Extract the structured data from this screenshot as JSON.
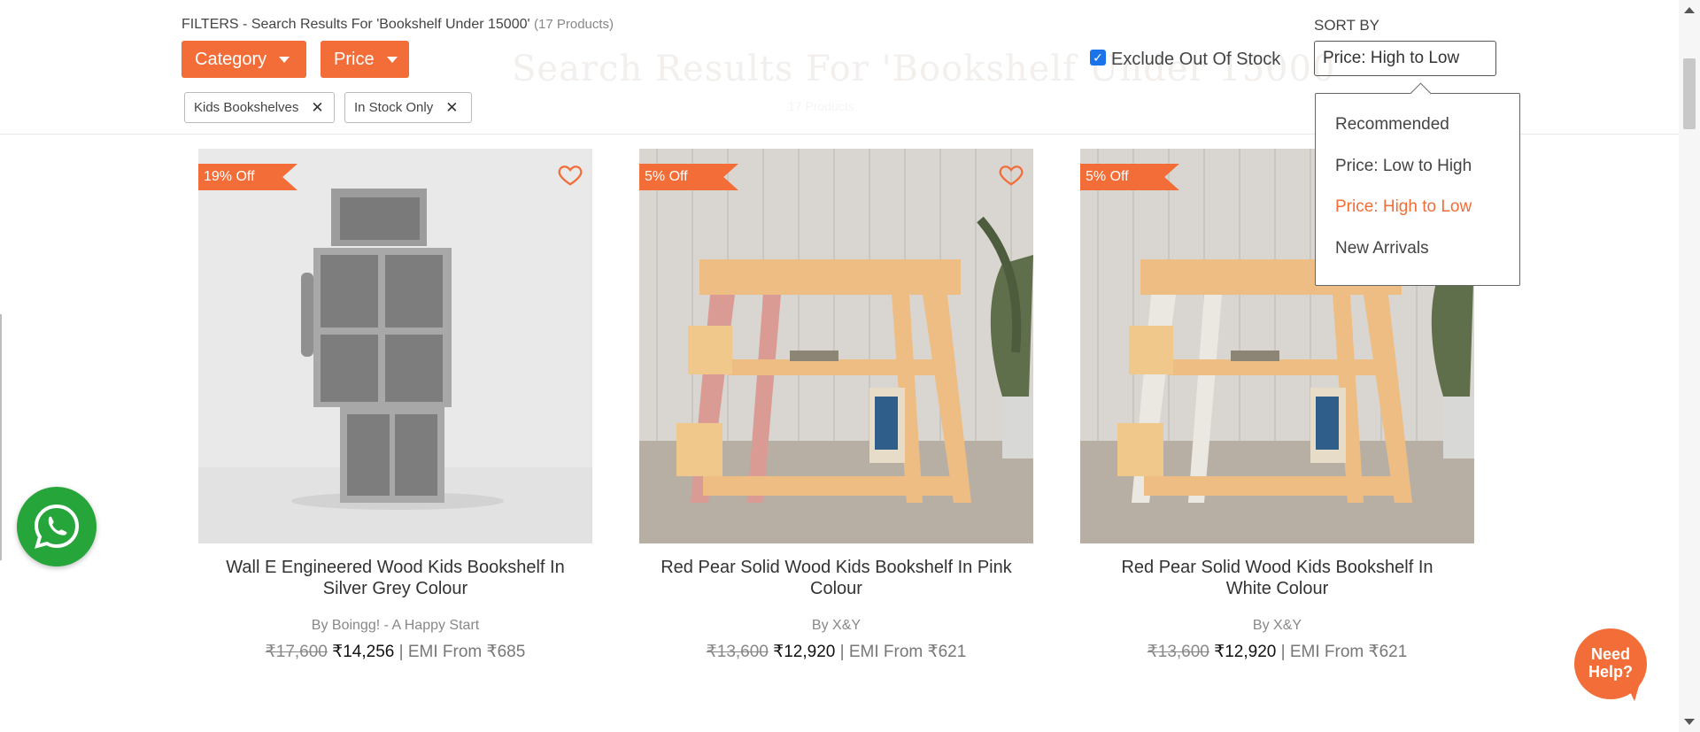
{
  "background_heading": {
    "title": "Search Results For 'Bookshelf Under 15000'",
    "subtitle": "17 Products"
  },
  "filters": {
    "heading": "FILTERS - Search Results For 'Bookshelf Under 15000'",
    "count": "(17 Products)",
    "category_label": "Category",
    "price_label": "Price",
    "chips": [
      "Kids Bookshelves",
      "In Stock Only"
    ],
    "exclude_out_of_stock": {
      "label": "Exclude Out Of Stock",
      "checked": true
    }
  },
  "sort": {
    "label": "SORT BY",
    "selected": "Price: High to Low",
    "options": [
      "Recommended",
      "Price: Low to High",
      "Price: High to Low",
      "New Arrivals"
    ],
    "active_index": 2
  },
  "products": [
    {
      "discount": "19% Off",
      "title": "Wall E Engineered Wood Kids Bookshelf In Silver Grey Colour",
      "brand": "By Boingg! - A Happy Start",
      "mrp": "₹17,600",
      "price": "₹14,256",
      "emi": "| EMI From ₹685",
      "wishlist_icon": "heart-outline-icon"
    },
    {
      "discount": "5% Off",
      "title": "Red Pear Solid Wood Kids Bookshelf In Pink Colour",
      "brand": "By X&Y",
      "mrp": "₹13,600",
      "price": "₹12,920",
      "emi": "| EMI From ₹621",
      "wishlist_icon": "heart-outline-icon"
    },
    {
      "discount": "5% Off",
      "title": "Red Pear Solid Wood Kids Bookshelf In White Colour",
      "brand": "By X&Y",
      "mrp": "₹13,600",
      "price": "₹12,920",
      "emi": "| EMI From ₹621",
      "wishlist_icon": "heart-outline-icon"
    }
  ],
  "help_widget": {
    "line1": "Need",
    "line2": "Help?"
  },
  "colors": {
    "accent": "#f26d38",
    "whatsapp": "#25a53a",
    "checkbox": "#1a73e8"
  },
  "icons": [
    "caret-down-icon",
    "close-icon",
    "heart-outline-icon",
    "whatsapp-icon",
    "chat-bubble-icon"
  ]
}
